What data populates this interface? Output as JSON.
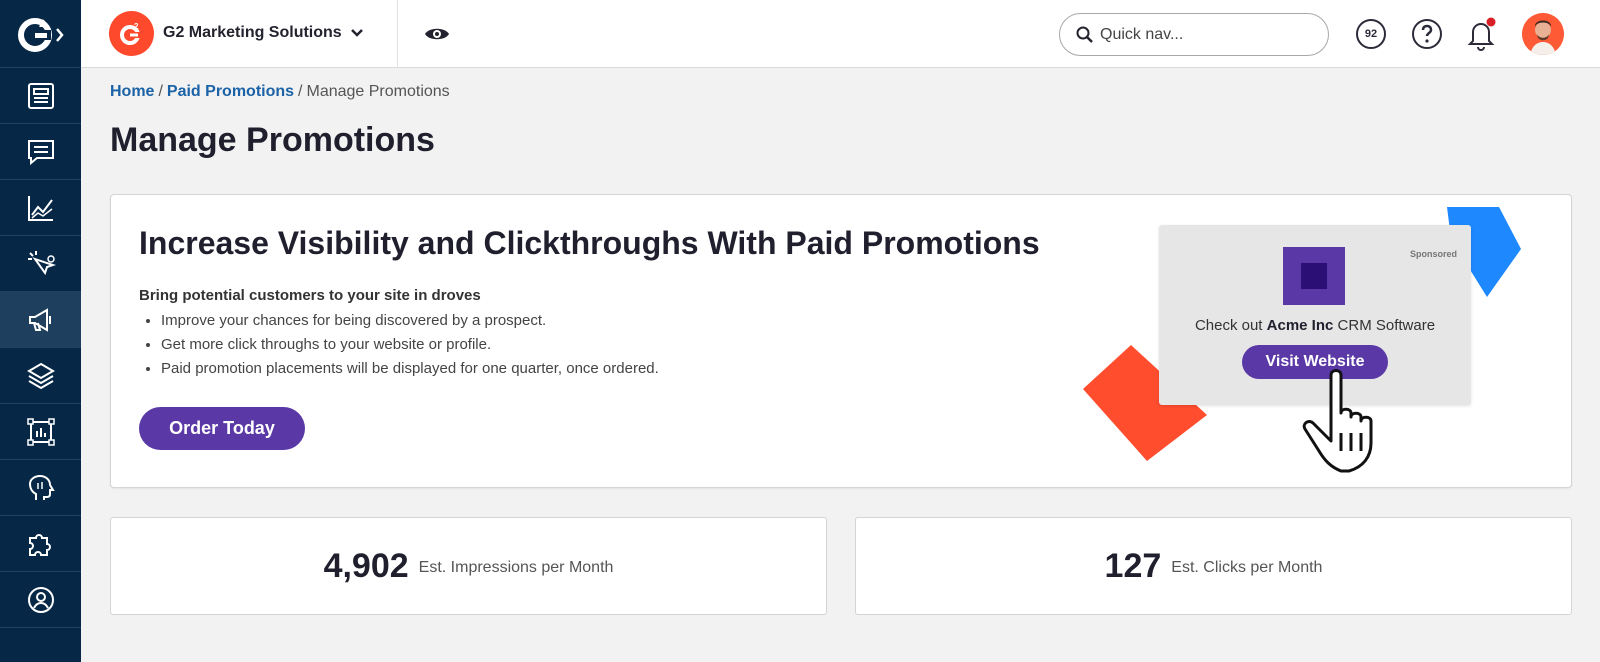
{
  "sidebar": {
    "logo_icon": "g2-logo-icon",
    "items": [
      {
        "icon": "dashboard-icon",
        "active": false
      },
      {
        "icon": "chat-icon",
        "active": false
      },
      {
        "icon": "chart-icon",
        "active": false
      },
      {
        "icon": "click-target-icon",
        "active": false
      },
      {
        "icon": "megaphone-icon",
        "active": true
      },
      {
        "icon": "layers-icon",
        "active": false
      },
      {
        "icon": "report-frame-icon",
        "active": false
      },
      {
        "icon": "head-profile-icon",
        "active": false
      },
      {
        "icon": "puzzle-icon",
        "active": false
      },
      {
        "icon": "user-circle-icon",
        "active": false
      }
    ]
  },
  "topbar": {
    "account_name": "G2 Marketing Solutions",
    "search_placeholder": "Quick nav...",
    "score": "92"
  },
  "breadcrumb": {
    "home": "Home",
    "paid_promotions": "Paid Promotions",
    "current": "Manage Promotions",
    "separator": "/"
  },
  "page": {
    "title": "Manage Promotions"
  },
  "promo": {
    "heading": "Increase Visibility and Clickthroughs With Paid Promotions",
    "subheading": "Bring potential customers to your site in droves",
    "bullets": [
      "Improve your chances for being discovered by a prospect.",
      "Get more click throughs to your website or profile.",
      "Paid promotion placements will be displayed for one quarter, once ordered."
    ],
    "order_button": "Order Today",
    "ad": {
      "sponsored": "Sponsored",
      "text_prefix": "Check out ",
      "company": "Acme Inc",
      "text_suffix": " CRM Software",
      "button": "Visit Website"
    }
  },
  "stats": [
    {
      "value": "4,902",
      "label": "Est. Impressions per Month"
    },
    {
      "value": "127",
      "label": "Est. Clicks per Month"
    }
  ],
  "colors": {
    "sidebar": "#062846",
    "brand_red": "#ff492c",
    "purple": "#5a39a6",
    "link_blue": "#1b63a6",
    "accent_blue": "#1e88ff"
  }
}
